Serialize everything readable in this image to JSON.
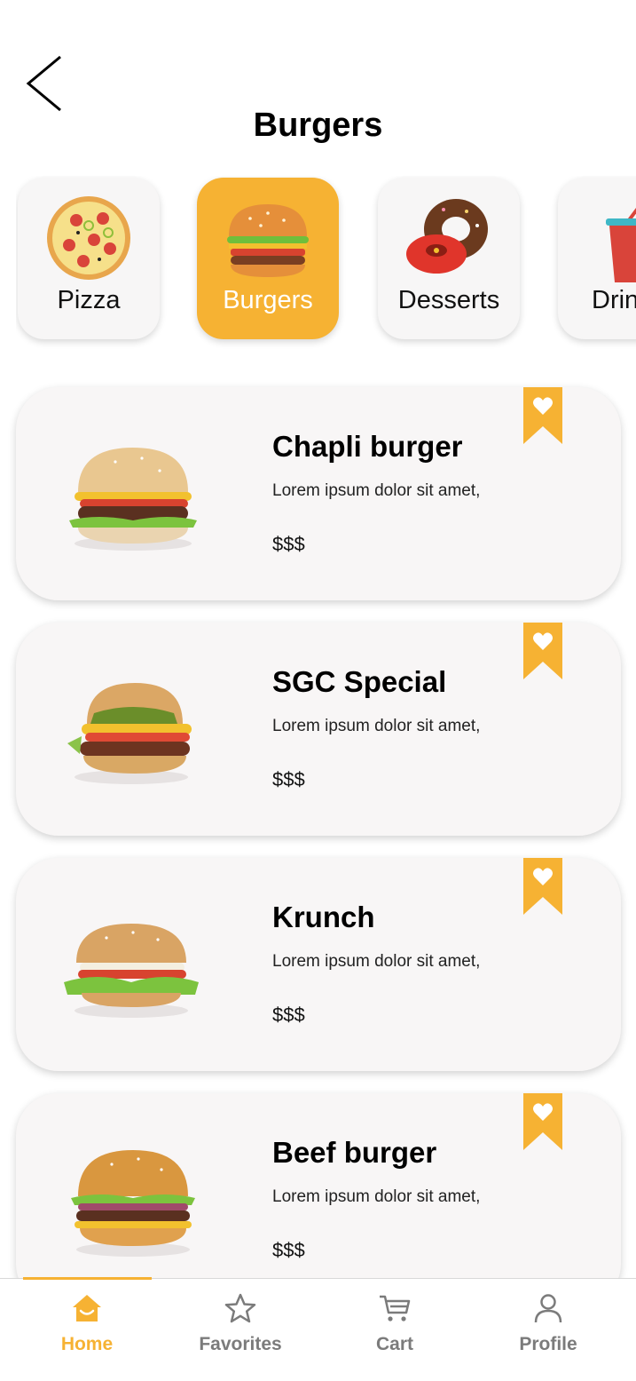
{
  "header": {
    "title": "Burgers"
  },
  "categories": [
    {
      "label": "Pizza",
      "active": false
    },
    {
      "label": "Burgers",
      "active": true
    },
    {
      "label": "Desserts",
      "active": false
    },
    {
      "label": "Drinks",
      "active": false
    }
  ],
  "items": [
    {
      "name": "Chapli burger",
      "description": "Lorem ipsum dolor sit amet,",
      "price": "$$$"
    },
    {
      "name": "SGC Special",
      "description": "Lorem ipsum dolor sit amet,",
      "price": "$$$"
    },
    {
      "name": "Krunch",
      "description": "Lorem ipsum dolor sit amet,",
      "price": "$$$"
    },
    {
      "name": "Beef burger",
      "description": "Lorem ipsum dolor sit amet,",
      "price": "$$$"
    }
  ],
  "nav": [
    {
      "label": "Home",
      "icon": "home-icon",
      "active": true
    },
    {
      "label": "Favorites",
      "icon": "star-icon",
      "active": false
    },
    {
      "label": "Cart",
      "icon": "cart-icon",
      "active": false
    },
    {
      "label": "Profile",
      "icon": "profile-icon",
      "active": false
    }
  ],
  "colors": {
    "accent": "#f6b233",
    "card": "#f8f6f6",
    "inactive": "#7b7b7b"
  }
}
